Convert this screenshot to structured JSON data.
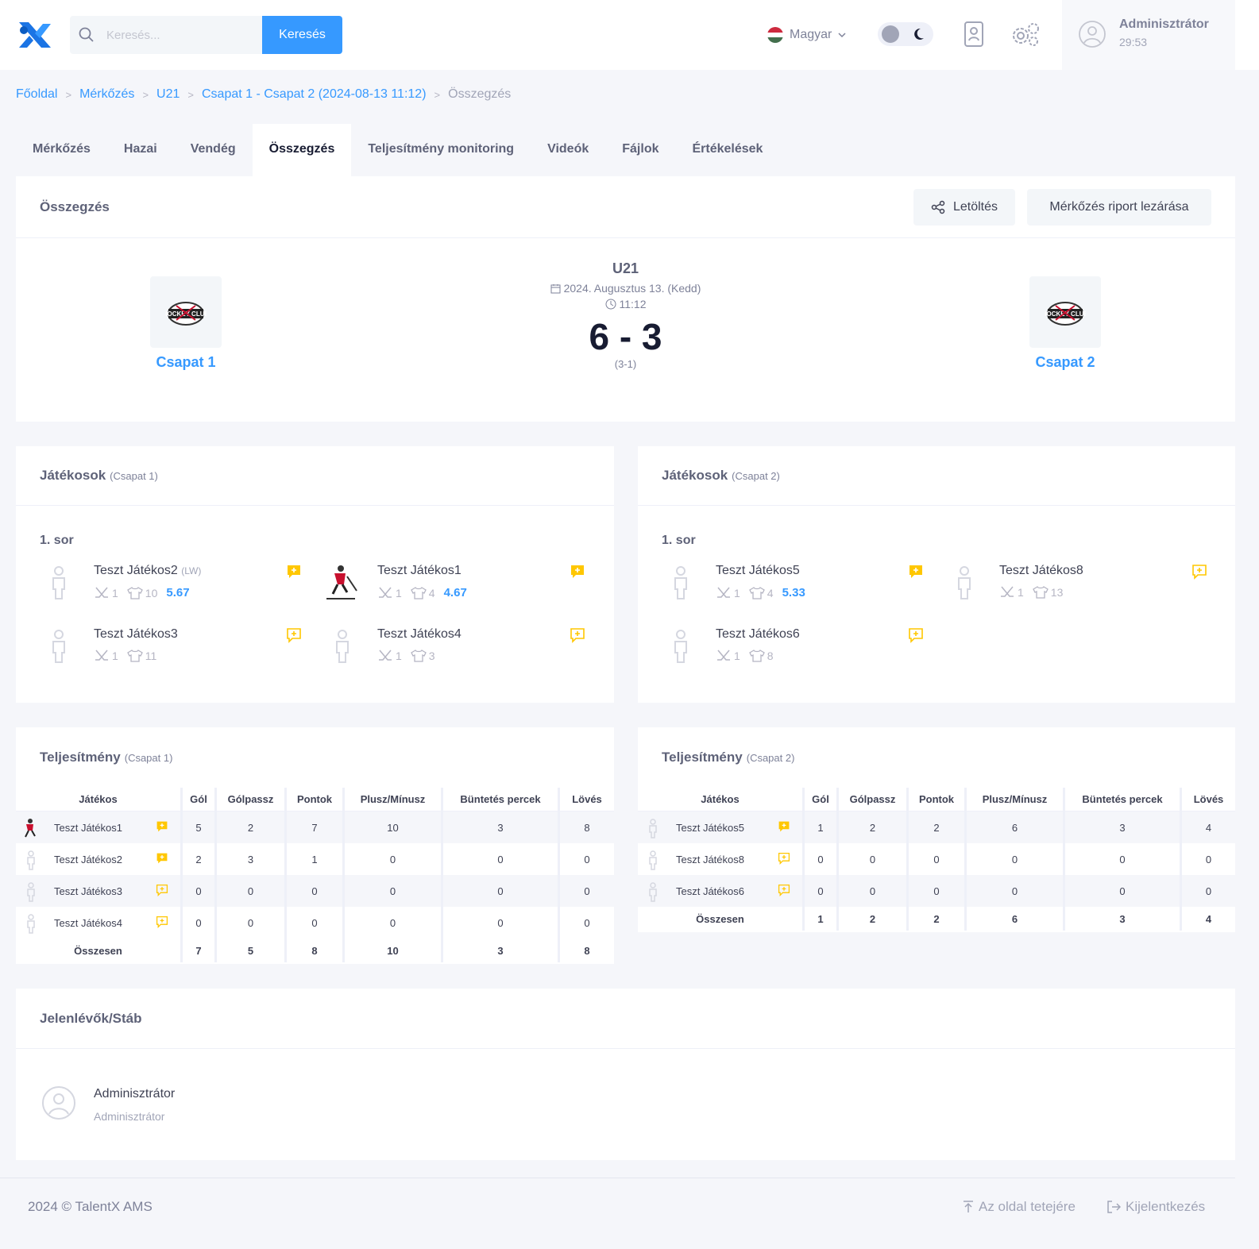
{
  "header": {
    "search_placeholder": "Keresés...",
    "search_button": "Keresés",
    "language": "Magyar",
    "user_name": "Adminisztrátor",
    "session_time": "29:53"
  },
  "breadcrumb": [
    "Főoldal",
    "Mérkőzés",
    "U21",
    "Csapat 1 - Csapat 2 (2024-08-13 11:12)",
    "Összegzés"
  ],
  "tabs": [
    "Mérkőzés",
    "Hazai",
    "Vendég",
    "Összegzés",
    "Teljesítmény monitoring",
    "Videók",
    "Fájlok",
    "Értékelések"
  ],
  "summary": {
    "title": "Összegzés",
    "download_button": "Letöltés",
    "close_button": "Mérkőzés riport lezárása",
    "category": "U21",
    "date": "2024. Augusztus 13. (Kedd)",
    "time": "11:12",
    "score": "6 - 3",
    "periods": "(3-1)",
    "home_team": "Csapat 1",
    "away_team": "Csapat 2",
    "logo_text": "HOCKEY CLUB"
  },
  "players_home": {
    "title": "Játékosok",
    "team": "(Csapat 1)",
    "line": "1. sor",
    "players": [
      {
        "name": "Teszt Játékos2",
        "pos": "(LW)",
        "games": "1",
        "number": "10",
        "rating": "5.67"
      },
      {
        "name": "Teszt Játékos1",
        "pos": "",
        "games": "1",
        "number": "4",
        "rating": "4.67"
      },
      {
        "name": "Teszt Játékos3",
        "pos": "",
        "games": "1",
        "number": "11",
        "rating": ""
      },
      {
        "name": "Teszt Játékos4",
        "pos": "",
        "games": "1",
        "number": "3",
        "rating": ""
      }
    ]
  },
  "players_away": {
    "title": "Játékosok",
    "team": "(Csapat 2)",
    "line": "1. sor",
    "players": [
      {
        "name": "Teszt Játékos5",
        "pos": "",
        "games": "1",
        "number": "4",
        "rating": "5.33"
      },
      {
        "name": "Teszt Játékos8",
        "pos": "",
        "games": "1",
        "number": "13",
        "rating": ""
      },
      {
        "name": "Teszt Játékos6",
        "pos": "",
        "games": "1",
        "number": "8",
        "rating": ""
      }
    ]
  },
  "perf_home": {
    "title": "Teljesítmény",
    "team": "(Csapat 1)",
    "headers": [
      "Játékos",
      "Gól",
      "Gólpassz",
      "Pontok",
      "Plusz/Mínusz",
      "Büntetés percek",
      "Lövés"
    ],
    "rows": [
      [
        "Teszt Játékos1",
        "5",
        "2",
        "7",
        "10",
        "3",
        "8"
      ],
      [
        "Teszt Játékos2",
        "2",
        "3",
        "1",
        "0",
        "0",
        "0"
      ],
      [
        "Teszt Játékos3",
        "0",
        "0",
        "0",
        "0",
        "0",
        "0"
      ],
      [
        "Teszt Játékos4",
        "0",
        "0",
        "0",
        "0",
        "0",
        "0"
      ]
    ],
    "total": [
      "Összesen",
      "7",
      "5",
      "8",
      "10",
      "3",
      "8"
    ]
  },
  "perf_away": {
    "title": "Teljesítmény",
    "team": "(Csapat 2)",
    "headers": [
      "Játékos",
      "Gól",
      "Gólpassz",
      "Pontok",
      "Plusz/Mínusz",
      "Büntetés percek",
      "Lövés"
    ],
    "rows": [
      [
        "Teszt Játékos5",
        "1",
        "2",
        "2",
        "6",
        "3",
        "4"
      ],
      [
        "Teszt Játékos8",
        "0",
        "0",
        "0",
        "0",
        "0",
        "0"
      ],
      [
        "Teszt Játékos6",
        "0",
        "0",
        "0",
        "0",
        "0",
        "0"
      ]
    ],
    "total": [
      "Összesen",
      "1",
      "2",
      "2",
      "6",
      "3",
      "4"
    ]
  },
  "staff": {
    "title": "Jelenlévők/Stáb",
    "name": "Adminisztrátor",
    "role": "Adminisztrátor"
  },
  "footer": {
    "copyright": "2024 © TalentX AMS",
    "to_top": "Az oldal tetejére",
    "logout": "Kijelentkezés"
  },
  "colors": {
    "primary": "#3699ff",
    "comment": "#ffc700",
    "background": "#f5f6fa"
  }
}
